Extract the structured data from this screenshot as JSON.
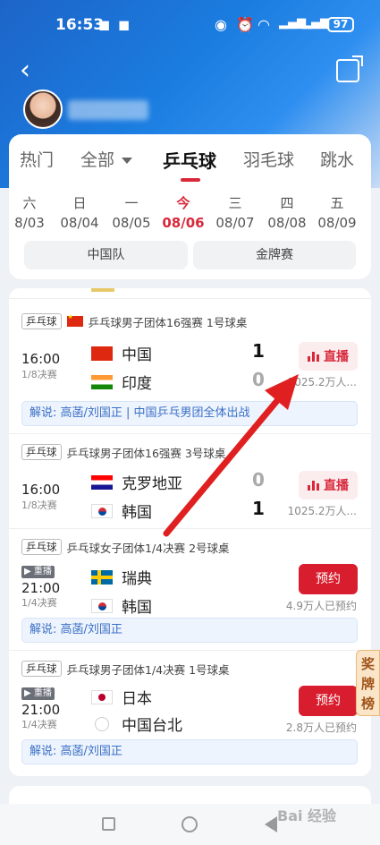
{
  "status_bar": {
    "time": "16:53",
    "battery": "97"
  },
  "categories": [
    "热门",
    "全部",
    "乒乓球",
    "羽毛球",
    "跳水"
  ],
  "active_category": "乒乓球",
  "days": [
    {
      "weekday": "六",
      "date": "8/03"
    },
    {
      "weekday": "日",
      "date": "08/04"
    },
    {
      "weekday": "一",
      "date": "08/05"
    },
    {
      "weekday": "今",
      "date": "08/06"
    },
    {
      "weekday": "三",
      "date": "08/07"
    },
    {
      "weekday": "四",
      "date": "08/08"
    },
    {
      "weekday": "五",
      "date": "08/09"
    }
  ],
  "filters": [
    "中国队",
    "金牌赛"
  ],
  "matches": [
    {
      "sport_tag": "乒乓球",
      "title": "乒乓球男子团体16强赛 1号球桌",
      "time": "16:00",
      "stage": "1/8决赛",
      "team1": "中国",
      "score1": "1",
      "team2": "印度",
      "score2": "0",
      "action": "直播",
      "meta": "1025.2万人...",
      "commentary": "解说: 高菡/刘国正 | 中国乒乓男团全体出战"
    },
    {
      "sport_tag": "乒乓球",
      "title": "乒乓球男子团体16强赛 3号球桌",
      "time": "16:00",
      "stage": "1/8决赛",
      "team1": "克罗地亚",
      "score1": "0",
      "team2": "韩国",
      "score2": "1",
      "action": "直播",
      "meta": "1025.2万人..."
    },
    {
      "sport_tag": "乒乓球",
      "title": "乒乓球女子团体1/4决赛 2号球桌",
      "badge": "▶ 重播",
      "time": "21:00",
      "stage": "1/4决赛",
      "team1": "瑞典",
      "team2": "韩国",
      "action": "预约",
      "meta": "4.9万人已预约",
      "commentary": "解说: 高菡/刘国正"
    },
    {
      "sport_tag": "乒乓球",
      "title": "乒乓球男子团体1/4决赛 1号球桌",
      "badge": "▶ 重播",
      "time": "21:00",
      "stage": "1/4决赛",
      "team1": "日本",
      "team2": "中国台北",
      "action": "预约",
      "meta": "2.8万人已预约",
      "commentary": "解说: 高菡/刘国正"
    }
  ],
  "side_tab": "奖牌榜",
  "watermark": "Bai 经验",
  "colors": {
    "accent": "#d8283a",
    "header_blue": "#1b7de0",
    "annotation_arrow": "#e02020"
  }
}
